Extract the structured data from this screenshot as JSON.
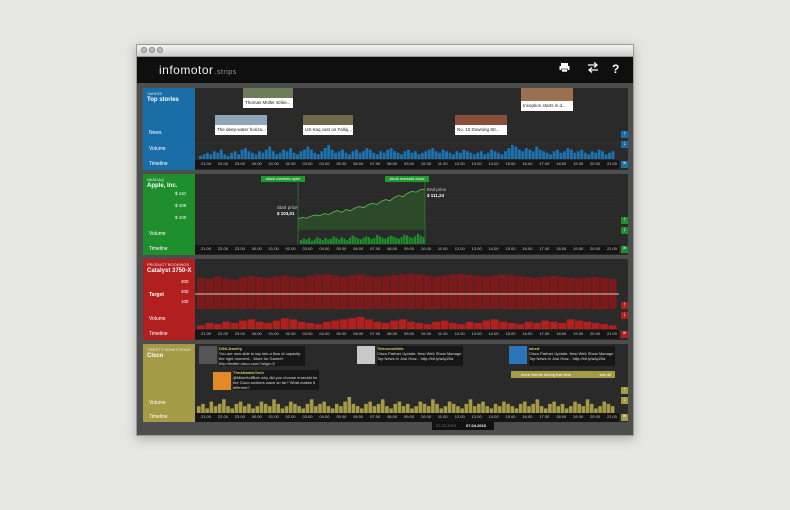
{
  "app": {
    "name": "infomotor",
    "suffix": ".strips"
  },
  "toolbar": {
    "print_icon": "printer-icon",
    "swap_icon": "arrows-swap-icon",
    "help_label": "?"
  },
  "timeline_ticks": [
    "21.00",
    "22.00",
    "23.00",
    "00.00",
    "01.00",
    "02.00",
    "03.00",
    "04.00",
    "05.00",
    "06.00",
    "07.00",
    "08.00",
    "09.00",
    "10.00",
    "11.00",
    "12.00",
    "13.00",
    "14.00",
    "15.00",
    "16.00",
    "17.00",
    "18.00",
    "19.00",
    "20.00",
    "21.00"
  ],
  "strips": {
    "news": {
      "category": "YAHOO!",
      "title": "Top stories",
      "label_news": "News",
      "label_volume": "Volume",
      "label_timeline": "Timeline",
      "color": "#1a6ea8",
      "headlines": [
        "Thomas Müller strike...",
        "The deep-water horiza...",
        "US-Iraq cast on Falluj...",
        "No. 10 Downing Str...",
        "Inception starts in d..."
      ],
      "volume": [
        2,
        3,
        4,
        3,
        5,
        4,
        6,
        3,
        2,
        4,
        5,
        3,
        6,
        7,
        5,
        4,
        3,
        5,
        4,
        6,
        8,
        5,
        3,
        4,
        6,
        5,
        7,
        4,
        3,
        5,
        6,
        8,
        6,
        4,
        3,
        5,
        7,
        9,
        6,
        4,
        5,
        6,
        4,
        3,
        5,
        6,
        4,
        5,
        7,
        6,
        4,
        3,
        5,
        4,
        6,
        7,
        5,
        4,
        3,
        5,
        6,
        4,
        5,
        3,
        4,
        5,
        6,
        7,
        5,
        4,
        6,
        5,
        4,
        3,
        5,
        4,
        6,
        5,
        4,
        3,
        4,
        5,
        3,
        4,
        6,
        5,
        4,
        3,
        5,
        7,
        9,
        8,
        6,
        5,
        7,
        6,
        5,
        8,
        6,
        5,
        4,
        3,
        5,
        6,
        4,
        5,
        7,
        6,
        4,
        5,
        6,
        4,
        3,
        5,
        4,
        6,
        5,
        3,
        4,
        5
      ]
    },
    "stock": {
      "category": "NASDAQ",
      "title": "Apple, Inc.",
      "label_volume": "Volume",
      "label_timeline": "Timeline",
      "color": "#1e8f2c",
      "tag_open": "stock markets open",
      "tag_close": "stock markets close",
      "y_labels": [
        "$ 110",
        "$ 105",
        "$ 100"
      ],
      "start_price_label": "Start price",
      "start_price": "$ 103,01",
      "end_price_label": "End price",
      "end_price": "$ 111,24",
      "price": [
        103.0,
        103.4,
        103.2,
        103.8,
        104.1,
        103.9,
        104.5,
        104.2,
        104.9,
        105.3,
        104.8,
        105.6,
        105.2,
        106.0,
        106.4,
        106.1,
        106.9,
        107.3,
        107.0,
        107.8,
        108.3,
        108.0,
        108.9,
        109.4,
        109.1,
        110.0,
        110.6,
        110.3,
        111.0,
        111.2
      ],
      "volume": [
        5,
        7,
        6,
        8,
        4,
        6,
        9,
        7,
        5,
        8,
        6,
        7,
        10,
        8,
        6,
        9,
        7,
        5,
        8,
        11,
        9,
        7,
        6,
        8,
        10,
        9,
        7,
        8,
        12,
        10,
        8,
        7,
        9,
        11,
        10,
        8,
        7,
        9,
        12,
        11,
        9,
        8,
        10,
        13,
        11,
        9
      ]
    },
    "product": {
      "category": "Product bookings",
      "title": "Catalyst 3750-X",
      "label_target": "Target",
      "label_volume": "Volume",
      "label_timeline": "Timeline",
      "color": "#b21f1f",
      "y_labels": [
        "300",
        "200",
        "100"
      ],
      "bookings": [
        260,
        250,
        270,
        255,
        245,
        265,
        275,
        268,
        260,
        272,
        280,
        270,
        262,
        276,
        285,
        290,
        278,
        270,
        282,
        288,
        276,
        268,
        274,
        283,
        290,
        295,
        286,
        278,
        272,
        280,
        288,
        292,
        284,
        276,
        270,
        278,
        286,
        280,
        274,
        268,
        262,
        270,
        276,
        268,
        260,
        255,
        262,
        268,
        258,
        250
      ],
      "volume": [
        3,
        5,
        4,
        6,
        5,
        7,
        8,
        6,
        5,
        7,
        9,
        8,
        6,
        5,
        4,
        6,
        7,
        8,
        9,
        10,
        8,
        6,
        5,
        7,
        8,
        6,
        5,
        4,
        6,
        7,
        5,
        4,
        6,
        5,
        7,
        8,
        6,
        5,
        4,
        6,
        5,
        7,
        6,
        5,
        8,
        7,
        6,
        5,
        4,
        3
      ]
    },
    "tweets": {
      "category": "TWEETS Monitoring",
      "title": "Cisco",
      "label_volume": "Volume",
      "label_timeline": "Timeline",
      "color": "#a59a45",
      "items": [
        {
          "user": "DSKJewelry",
          "text": "You are now able to tap into a flow of capacity the right moment... More for Gannet: http://twitter.cisco.com/?align=5"
        },
        {
          "user": "TheAtlanticTech",
          "text": "@MikeHoffBee why did you choose emerald for the Cisco workers wave so far? What makes it different?"
        },
        {
          "user": "TelecomsWeb",
          "text": "Cisco Partner Update: New Web Show Manage Top News in Just How... http://bit.ly/aAy20a"
        },
        {
          "user": "wired",
          "text": "Cisco Partner Update: New Web Show Manage Top News in Just How... http://bit.ly/aAy20a"
        }
      ],
      "more_tweets": "more tweets during this time",
      "see_all": "see all",
      "volume": [
        3,
        4,
        2,
        5,
        3,
        4,
        6,
        3,
        2,
        4,
        5,
        3,
        4,
        2,
        3,
        5,
        4,
        3,
        6,
        4,
        2,
        3,
        5,
        4,
        3,
        2,
        4,
        6,
        3,
        4,
        5,
        3,
        2,
        4,
        3,
        5,
        7,
        4,
        3,
        2,
        4,
        5,
        3,
        4,
        6,
        3,
        2,
        4,
        5,
        3,
        4,
        2,
        3,
        5,
        4,
        3,
        6,
        4,
        2,
        3,
        5,
        4,
        3,
        2,
        4,
        6,
        3,
        4,
        5,
        3,
        2,
        4,
        3,
        5,
        4,
        3,
        2,
        4,
        5,
        3,
        4,
        6,
        3,
        2,
        4,
        5,
        3,
        4,
        2,
        3,
        5,
        4,
        3,
        6,
        4,
        2,
        3,
        5,
        4,
        3
      ]
    }
  },
  "date_range": {
    "start": "07.03.2010",
    "end": "07.04.2010"
  }
}
